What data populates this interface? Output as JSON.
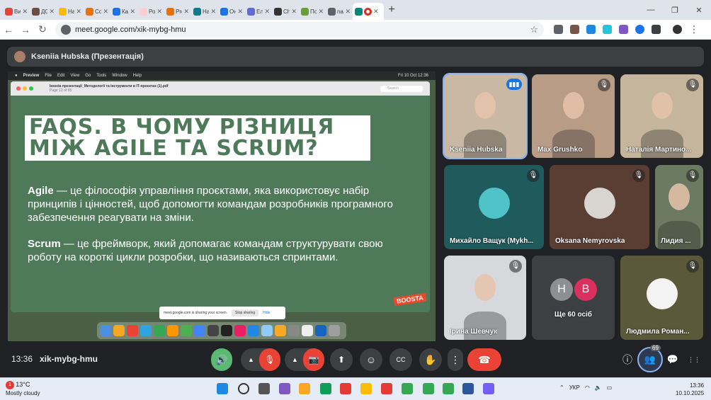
{
  "browser": {
    "tabs": [
      {
        "title": "Ви з",
        "color": "#ea4335"
      },
      {
        "title": "ДО",
        "color": "#6d4c41"
      },
      {
        "title": "Нав",
        "color": "#fbbc04"
      },
      {
        "title": "Cou",
        "color": "#e8710a"
      },
      {
        "title": "Каб",
        "color": "#1a73e8"
      },
      {
        "title": "Роз",
        "color": "#ffcdd2"
      },
      {
        "title": "Pro",
        "color": "#e8710a"
      },
      {
        "title": "Нав",
        "color": "#0f7a8c"
      },
      {
        "title": "Онл",
        "color": "#1a73e8"
      },
      {
        "title": "Еле",
        "color": "#5f6bd9"
      },
      {
        "title": "Cha",
        "color": "#333333"
      },
      {
        "title": "Пор",
        "color": "#689f38"
      },
      {
        "title": "nau",
        "color": "#5f6368"
      }
    ],
    "active_tab_title": "",
    "close_glyph": "✕",
    "new_tab_glyph": "+",
    "url": "meet.google.com/xik-mybg-hmu",
    "back_glyph": "←",
    "forward_glyph": "→",
    "reload_glyph": "↻",
    "star_glyph": "☆",
    "menu_glyph": "⋮",
    "min_glyph": "—",
    "max_glyph": "❐",
    "close_win_glyph": "✕"
  },
  "meet": {
    "presenter_label": "Kseniia Hubska (Презентація)",
    "time": "13:36",
    "code": "xik-mybg-hmu",
    "people_count": "69",
    "participants": [
      {
        "name": "Kseniia Hubska",
        "speaking": true
      },
      {
        "name": "Max Grushko",
        "muted": true
      },
      {
        "name": "Наталія Мартино...",
        "muted": true
      },
      {
        "name": "Михайло Ващук (Mykh...",
        "muted": true
      },
      {
        "name": "Oksana Nemyrovska",
        "muted": true
      },
      {
        "name": "Лидия ...",
        "muted": true
      },
      {
        "name": "Ірина Шевчук",
        "muted": true
      },
      {
        "name": "Ще 60 осіб",
        "initial1": "Н",
        "initial2": "В"
      },
      {
        "name": "Людмила Роман...",
        "muted": true
      }
    ],
    "mic_muted_glyph": "🎙",
    "controls": {
      "up": "▲",
      "raise": "✋",
      "more": "⋮",
      "end": "☎",
      "info": "ⓘ",
      "chat": "💬",
      "apps": "⋮⋮",
      "emoji": "☺",
      "present": "⬆",
      "cc": "CC",
      "speaker": "🔊",
      "mic": "🎙",
      "cam": "📷"
    }
  },
  "screen": {
    "mac_menu": [
      "Preview",
      "File",
      "Edit",
      "View",
      "Go",
      "Tools",
      "Window",
      "Help"
    ],
    "mac_clock": "Fri 10 Oct 12:36",
    "pdf_title": "boosta презентації_Методології та інструменти в ІТ-проєктах (1).pdf",
    "pdf_page": "Page 12 of 65",
    "pdf_search": "Search",
    "slide_title": "FAQS. В ЧОМУ РІЗНИЦЯ МІЖ AGILE ТА SCRUM?",
    "agile_term": "Agile",
    "agile_text": " — це філософія управління проєктами, яка використовує набір принципів і цінностей, щоб допомогти командам розробників програмного забезпечення реагувати на зміни.",
    "scrum_term": "Scrum",
    "scrum_text": " — це фреймворк, який допомагає командам структурувати свою роботу на короткі цикли розробки, що називаються спринтами.",
    "brand": "BOOSTA",
    "share_note": "meet.google.com is sharing your screen.",
    "stop_sharing": "Stop sharing",
    "hide": "Hide"
  },
  "taskbar": {
    "weather_temp": "13°C",
    "weather_desc": "Mostly cloudy",
    "weather_badge": "1",
    "lang": "УКР",
    "time": "13:36",
    "date": "10.10.2025"
  }
}
